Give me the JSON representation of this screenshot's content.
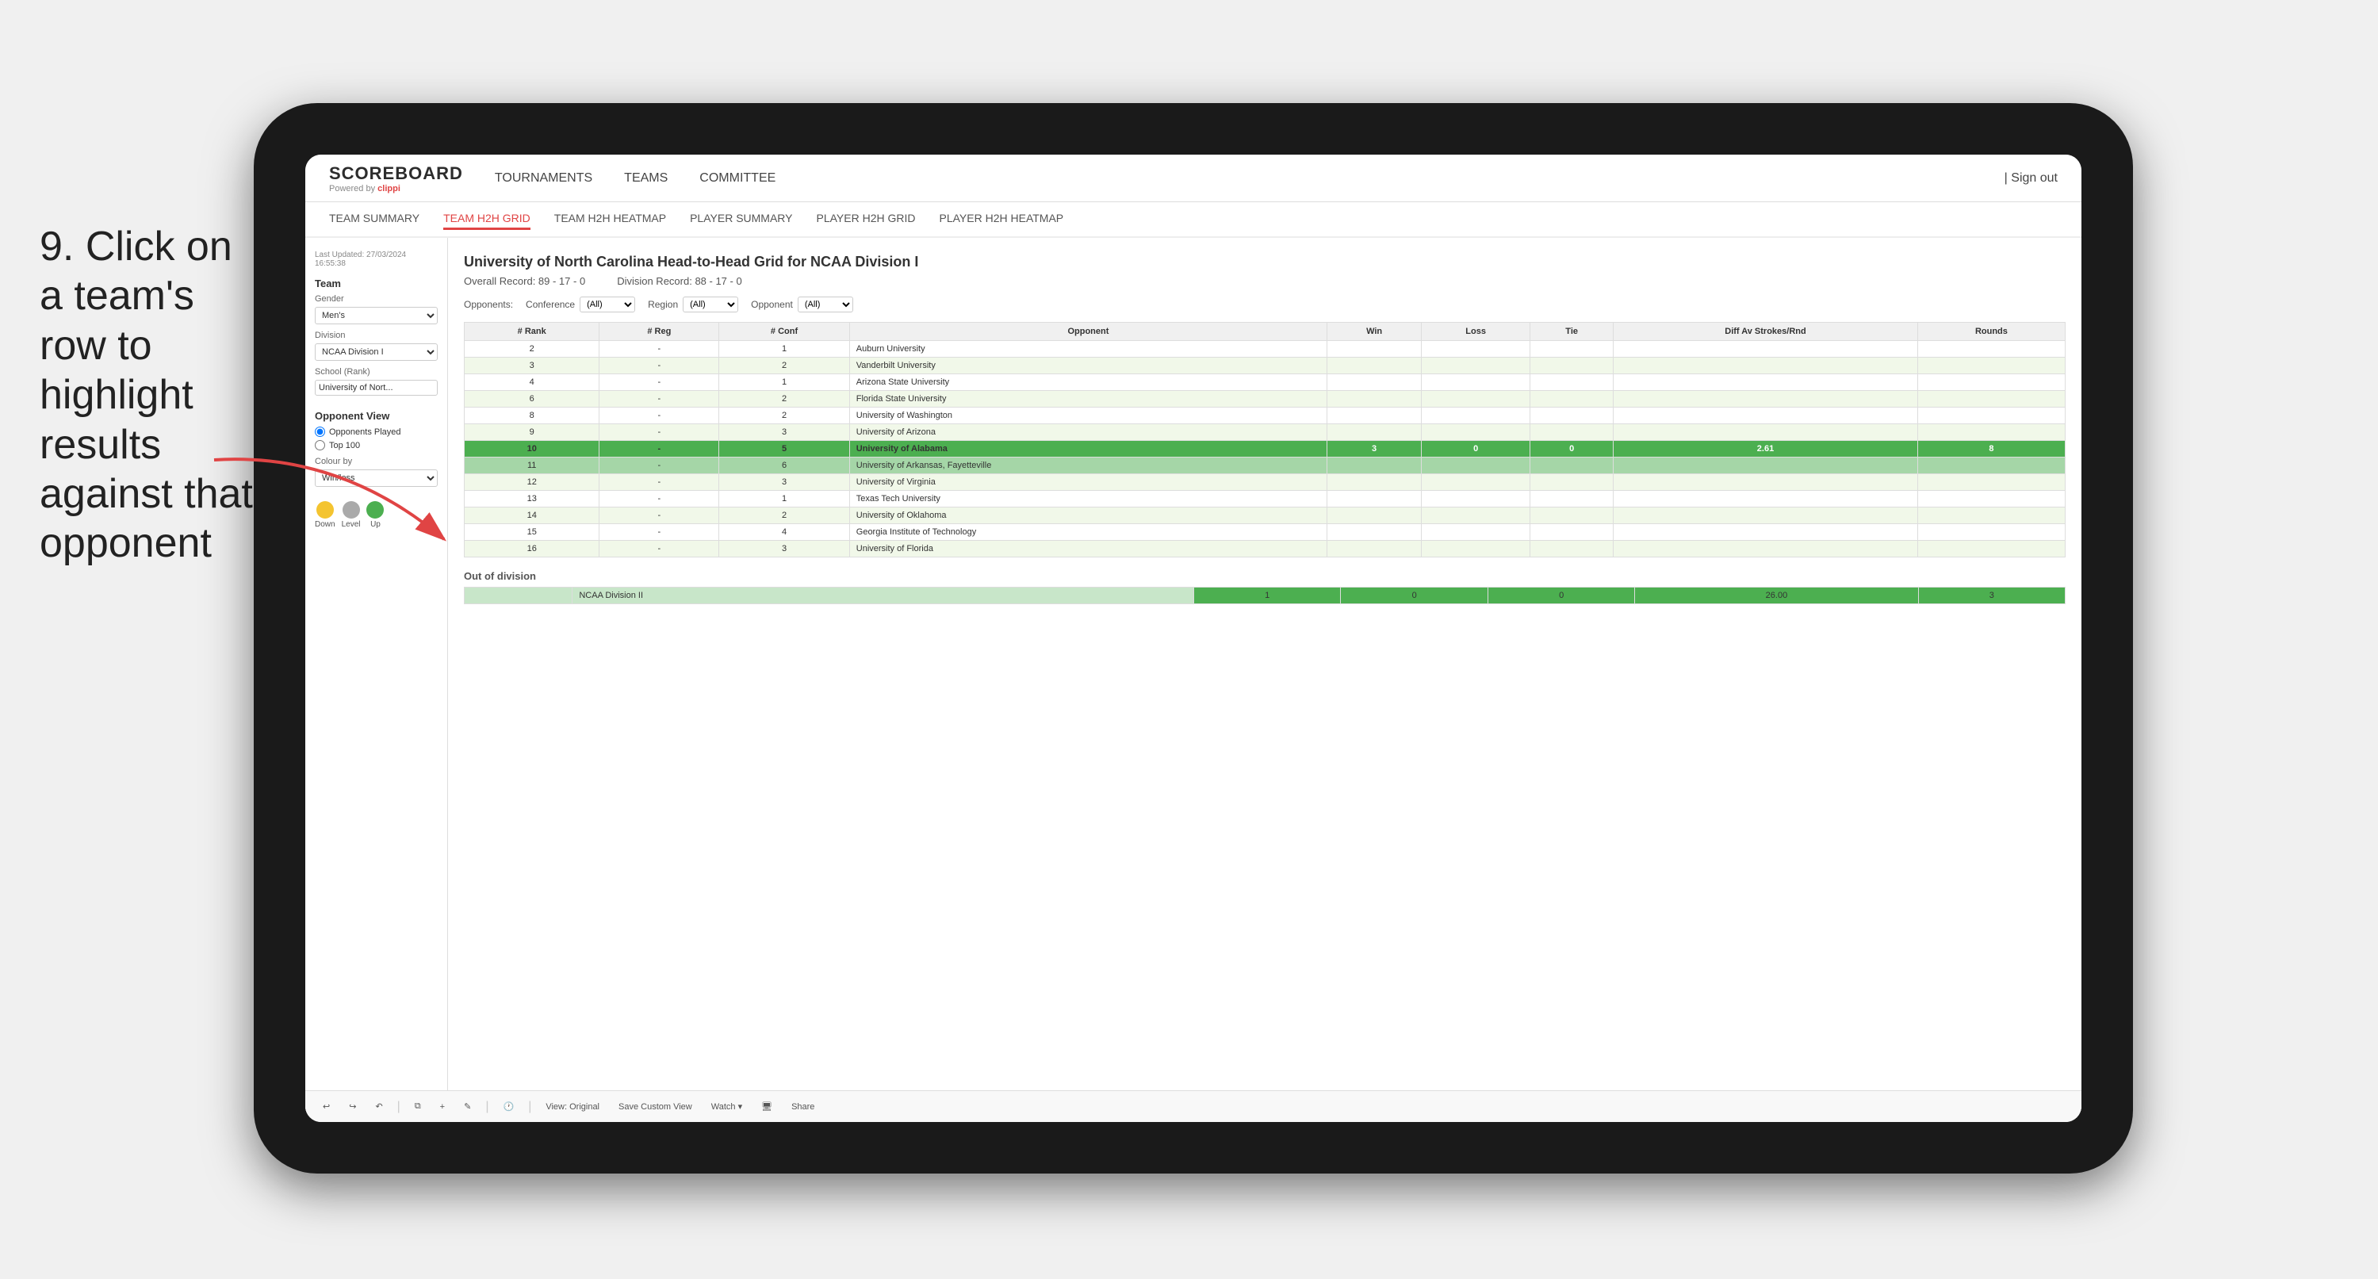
{
  "instruction": {
    "step": "9.",
    "text": "Click on a team's row to highlight results against that opponent"
  },
  "app": {
    "logo": "SCOREBOARD",
    "powered_by": "Powered by clippi",
    "nav_links": [
      "TOURNAMENTS",
      "TEAMS",
      "COMMITTEE"
    ],
    "sign_out": "Sign out",
    "sub_nav": [
      {
        "label": "TEAM SUMMARY",
        "active": false
      },
      {
        "label": "TEAM H2H GRID",
        "active": true
      },
      {
        "label": "TEAM H2H HEATMAP",
        "active": false
      },
      {
        "label": "PLAYER SUMMARY",
        "active": false
      },
      {
        "label": "PLAYER H2H GRID",
        "active": false
      },
      {
        "label": "PLAYER H2H HEATMAP",
        "active": false
      }
    ]
  },
  "left_panel": {
    "last_updated_label": "Last Updated: 27/03/2024",
    "last_updated_time": "16:55:38",
    "team_label": "Team",
    "gender_label": "Gender",
    "gender_value": "Men's",
    "division_label": "Division",
    "division_value": "NCAA Division I",
    "school_label": "School (Rank)",
    "school_value": "University of Nort...",
    "opponent_view_label": "Opponent View",
    "radio_opponents": "Opponents Played",
    "radio_top100": "Top 100",
    "colour_by_label": "Colour by",
    "colour_by_value": "Win/loss",
    "legend": [
      {
        "color": "#f4c430",
        "label": "Down"
      },
      {
        "color": "#aaaaaa",
        "label": "Level"
      },
      {
        "color": "#4caf50",
        "label": "Up"
      }
    ]
  },
  "grid": {
    "title": "University of North Carolina Head-to-Head Grid for NCAA Division I",
    "overall_record": "Overall Record: 89 - 17 - 0",
    "division_record": "Division Record: 88 - 17 - 0",
    "filters": {
      "opponents_label": "Opponents:",
      "conference_label": "Conference",
      "conference_value": "(All)",
      "region_label": "Region",
      "region_value": "(All)",
      "opponent_label": "Opponent",
      "opponent_value": "(All)"
    },
    "columns": [
      "# Rank",
      "# Reg",
      "# Conf",
      "Opponent",
      "Win",
      "Loss",
      "Tie",
      "Diff Av Strokes/Rnd",
      "Rounds"
    ],
    "rows": [
      {
        "rank": "2",
        "reg": "-",
        "conf": "1",
        "opponent": "Auburn University",
        "win": "",
        "loss": "",
        "tie": "",
        "diff": "",
        "rounds": "",
        "color": "normal"
      },
      {
        "rank": "3",
        "reg": "-",
        "conf": "2",
        "opponent": "Vanderbilt University",
        "win": "",
        "loss": "",
        "tie": "",
        "diff": "",
        "rounds": "",
        "color": "light-green"
      },
      {
        "rank": "4",
        "reg": "-",
        "conf": "1",
        "opponent": "Arizona State University",
        "win": "",
        "loss": "",
        "tie": "",
        "diff": "",
        "rounds": "",
        "color": "normal"
      },
      {
        "rank": "6",
        "reg": "-",
        "conf": "2",
        "opponent": "Florida State University",
        "win": "",
        "loss": "",
        "tie": "",
        "diff": "",
        "rounds": "",
        "color": "light-green"
      },
      {
        "rank": "8",
        "reg": "-",
        "conf": "2",
        "opponent": "University of Washington",
        "win": "",
        "loss": "",
        "tie": "",
        "diff": "",
        "rounds": "",
        "color": "normal"
      },
      {
        "rank": "9",
        "reg": "-",
        "conf": "3",
        "opponent": "University of Arizona",
        "win": "",
        "loss": "",
        "tie": "",
        "diff": "",
        "rounds": "",
        "color": "light-green"
      },
      {
        "rank": "10",
        "reg": "-",
        "conf": "5",
        "opponent": "University of Alabama",
        "win": "3",
        "loss": "0",
        "tie": "0",
        "diff": "2.61",
        "rounds": "8",
        "color": "highlighted"
      },
      {
        "rank": "11",
        "reg": "-",
        "conf": "6",
        "opponent": "University of Arkansas, Fayetteville",
        "win": "",
        "loss": "",
        "tie": "",
        "diff": "",
        "rounds": "",
        "color": "selected"
      },
      {
        "rank": "12",
        "reg": "-",
        "conf": "3",
        "opponent": "University of Virginia",
        "win": "",
        "loss": "",
        "tie": "",
        "diff": "",
        "rounds": "",
        "color": "light-green"
      },
      {
        "rank": "13",
        "reg": "-",
        "conf": "1",
        "opponent": "Texas Tech University",
        "win": "",
        "loss": "",
        "tie": "",
        "diff": "",
        "rounds": "",
        "color": "normal"
      },
      {
        "rank": "14",
        "reg": "-",
        "conf": "2",
        "opponent": "University of Oklahoma",
        "win": "",
        "loss": "",
        "tie": "",
        "diff": "",
        "rounds": "",
        "color": "light-green"
      },
      {
        "rank": "15",
        "reg": "-",
        "conf": "4",
        "opponent": "Georgia Institute of Technology",
        "win": "",
        "loss": "",
        "tie": "",
        "diff": "",
        "rounds": "",
        "color": "normal"
      },
      {
        "rank": "16",
        "reg": "-",
        "conf": "3",
        "opponent": "University of Florida",
        "win": "",
        "loss": "",
        "tie": "",
        "diff": "",
        "rounds": "",
        "color": "light-green"
      }
    ],
    "out_of_division_label": "Out of division",
    "out_of_division_row": {
      "division": "NCAA Division II",
      "win": "1",
      "loss": "0",
      "tie": "0",
      "diff": "26.00",
      "rounds": "3"
    }
  },
  "toolbar": {
    "buttons": [
      "View: Original",
      "Save Custom View",
      "Watch ▾",
      "Share"
    ]
  }
}
